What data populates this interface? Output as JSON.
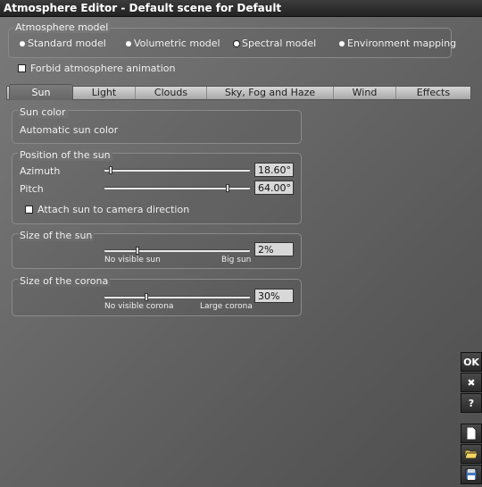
{
  "window": {
    "title": "Atmosphere Editor - Default scene for Default"
  },
  "atmosphere_model": {
    "label": "Atmosphere model",
    "options": [
      {
        "label": "Standard model",
        "selected": false
      },
      {
        "label": "Volumetric model",
        "selected": false
      },
      {
        "label": "Spectral model",
        "selected": true
      },
      {
        "label": "Environment mapping",
        "selected": false
      }
    ]
  },
  "forbid_animation": {
    "label": "Forbid atmosphere animation",
    "checked": false
  },
  "tabs": [
    {
      "label": "Sun",
      "active": true
    },
    {
      "label": "Light",
      "active": false
    },
    {
      "label": "Clouds",
      "active": false
    },
    {
      "label": "Sky, Fog and Haze",
      "active": false
    },
    {
      "label": "Wind",
      "active": false
    },
    {
      "label": "Effects",
      "active": false
    }
  ],
  "sun_color": {
    "label": "Sun color",
    "value": "Automatic sun color"
  },
  "position": {
    "label": "Position of the sun",
    "azimuth": {
      "label": "Azimuth",
      "value": "18.60°",
      "slider": 0.05
    },
    "pitch": {
      "label": "Pitch",
      "value": "64.00°",
      "slider": 0.85
    },
    "attach": {
      "label": "Attach sun to camera direction",
      "checked": false
    }
  },
  "sun_size": {
    "label": "Size of the sun",
    "value": "2%",
    "slider": 0.23,
    "min_label": "No visible sun",
    "max_label": "Big sun"
  },
  "corona_size": {
    "label": "Size of the corona",
    "value": "30%",
    "slider": 0.29,
    "min_label": "No visible corona",
    "max_label": "Large corona"
  },
  "side_buttons": {
    "ok": "OK",
    "cancel": "✖",
    "help": "?"
  }
}
